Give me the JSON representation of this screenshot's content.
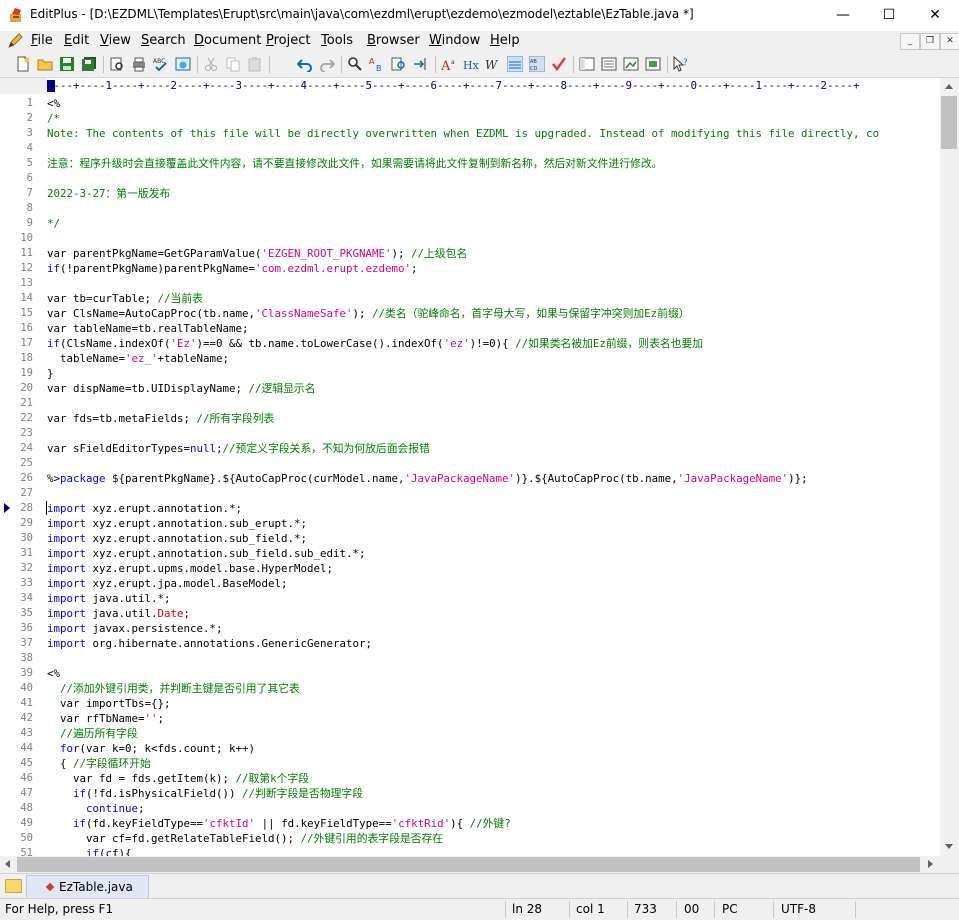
{
  "window": {
    "title": "EditPlus - [D:\\EZDML\\Templates\\Erupt\\src\\main\\java\\com\\ezdml\\erupt\\ezdemo\\ezmodel\\eztable\\EzTable.java *]",
    "minimize": "—",
    "maximize": "☐",
    "close": "✕"
  },
  "menu": [
    {
      "u": "F",
      "rest": "ile"
    },
    {
      "u": "E",
      "rest": "dit"
    },
    {
      "u": "V",
      "rest": "iew"
    },
    {
      "u": "S",
      "rest": "earch"
    },
    {
      "u": "D",
      "rest": "ocument"
    },
    {
      "u": "P",
      "rest": "roject"
    },
    {
      "u": "T",
      "rest": "ools"
    },
    {
      "u": "B",
      "rest": "rowser"
    },
    {
      "u": "W",
      "rest": "indow"
    },
    {
      "u": "H",
      "rest": "elp"
    }
  ],
  "mdi": {
    "min": "_",
    "restore": "❐",
    "close": "✕"
  },
  "ruler": "----+----1----+----2----+----3----+----4----+----5----+----6----+----7----+----8----+----9----+----0----+----1----+----2----+",
  "code": {
    "l1": "<%",
    "l2": "/*",
    "l3": "Note: The contents of this file will be directly overwritten when EZDML is upgraded. Instead of modifying this file directly, co",
    "l5": "注意：程序升级时会直接覆盖此文件内容，请不要直接修改此文件，如果需要请将此文件复制到新名称，然后对新文件进行修改。",
    "l7": "2022-3-27：第一版发布",
    "l9": "*/",
    "l11a": "var parentPkgName=GetGParamValue(",
    "l11s": "'EZGEN_ROOT_PKGNAME'",
    "l11b": "); ",
    "l11c": "//上级包名",
    "l12k": "if",
    "l12a": "(!parentPkgName)parentPkgName=",
    "l12s": "'com.ezdml.erupt.ezdemo'",
    "l12b": ";",
    "l14a": "var tb=curTable; ",
    "l14c": "//当前表",
    "l15a": "var ClsName=AutoCapProc(tb.name,",
    "l15s": "'ClassNameSafe'",
    "l15b": "); ",
    "l15c": "//类名（驼峰命名，首字母大写，如果与保留字冲突则加Ez前缀）",
    "l16": "var tableName=tb.realTableName;",
    "l17k": "if",
    "l17a": "(ClsName.indexOf(",
    "l17s1": "'Ez'",
    "l17b": ")==0 && tb.name.toLowerCase().indexOf(",
    "l17s2": "'ez'",
    "l17d": ")!=0){ ",
    "l17c": "//如果类名被加Ez前缀，则表名也要加",
    "l18a": "  tableName=",
    "l18s": "'ez_'",
    "l18b": "+tableName;",
    "l19": "}",
    "l20a": "var dispName=tb.UIDisplayName; ",
    "l20c": "//逻辑显示名",
    "l22a": "var fds=tb.metaFields; ",
    "l22c": "//所有字段列表",
    "l24a": "var sFieldEditorTypes=",
    "l24k": "null",
    "l24b": ";",
    "l24c": "//预定义字段关系，不知为何放后面会报错",
    "l26a": "%>",
    "l26k": "package",
    "l26b": " ${parentPkgName}.${AutoCapProc(curModel.name,",
    "l26s1": "'JavaPackageName'",
    "l26d": ")}.${AutoCapProc(tb.name,",
    "l26s2": "'JavaPackageName'",
    "l26e": ")};",
    "kimport": "import",
    "l28": " xyz.erupt.annotation.*;",
    "l29": " xyz.erupt.annotation.sub_erupt.*;",
    "l30": " xyz.erupt.annotation.sub_field.*;",
    "l31": " xyz.erupt.annotation.sub_field.sub_edit.*;",
    "l32": " xyz.erupt.upms.model.base.HyperModel;",
    "l33": " xyz.erupt.jpa.model.BaseModel;",
    "l34": " java.util.*;",
    "l35a": " java.util.",
    "l35r": "Date",
    "l35b": ";",
    "l36": " javax.persistence.*;",
    "l37": " org.hibernate.annotations.GenericGenerator;",
    "l39": "<%",
    "l40c": "  //添加外键引用类，并判断主键是否引用了其它表",
    "l41": "  var importTbs={};",
    "l42a": "  var rfTbName=",
    "l42s": "''",
    "l42b": ";",
    "l43c": "  //遍历所有字段",
    "l44a": "  ",
    "l44k": "for",
    "l44b": "(var k=0; k<fds.count; k++)",
    "l45a": "  { ",
    "l45c": "//字段循环开始",
    "l46a": "    var fd = fds.getItem(k); ",
    "l46c": "//取第k个字段",
    "l47a": "    ",
    "l47k": "if",
    "l47b": "(!fd.isPhysicalField()) ",
    "l47c": "//判断字段是否物理字段",
    "l48a": "      ",
    "l48k": "continue",
    "l48b": ";",
    "l49a": "    ",
    "l49k": "if",
    "l49b": "(fd.keyFieldType==",
    "l49s1": "'cfktId'",
    "l49d": " || fd.keyFieldType==",
    "l49s2": "'cfktRid'",
    "l49e": "){ ",
    "l49c": "//外键?",
    "l50a": "      var cf=fd.getRelateTableField(); ",
    "l50c": "//外键引用的表字段是否存在",
    "l51a": "      ",
    "l51k": "if",
    "l51b": "(cf){"
  },
  "tab": {
    "name": "EzTable.java"
  },
  "status": {
    "help": "For Help, press F1",
    "ln": "ln 28",
    "col": "col 1",
    "chars": "733",
    "sel": "00",
    "mode": "PC",
    "encoding": "UTF-8"
  }
}
